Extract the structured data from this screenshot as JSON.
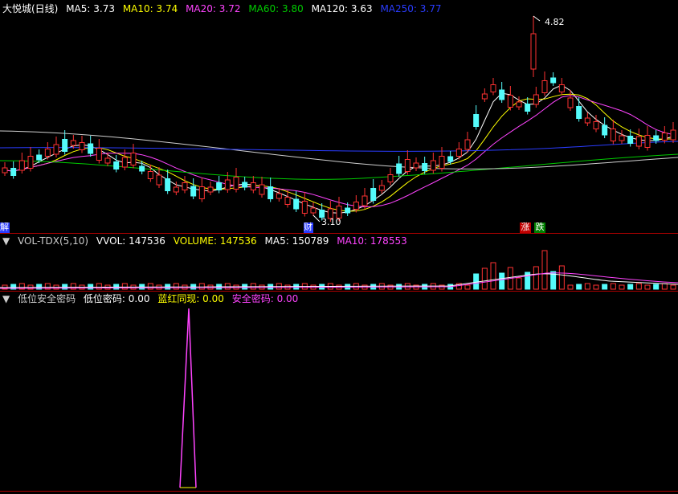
{
  "main": {
    "title": "大悦城(日线)",
    "ma": [
      {
        "label": "MA5: 3.73",
        "color": "#ffffff"
      },
      {
        "label": "MA10: 3.74",
        "color": "#ffff00"
      },
      {
        "label": "MA20: 3.72",
        "color": "#ff44ff"
      },
      {
        "label": "MA60: 3.80",
        "color": "#00cc00"
      },
      {
        "label": "MA120: 3.63",
        "color": "#ffffff"
      },
      {
        "label": "MA250: 3.77",
        "color": "#2a3cff"
      }
    ],
    "high_label": "4.82",
    "low_label": "3.10",
    "tag_left": "解",
    "tag_cai": "财",
    "tag_zhang": "涨",
    "tag_die": "跌"
  },
  "volume": {
    "legend": [
      {
        "label": "VOL-TDX(5,10)",
        "color": "#cccccc"
      },
      {
        "label": "VVOL: 147536",
        "color": "#ffffff"
      },
      {
        "label": "VOLUME: 147536",
        "color": "#ffff00"
      },
      {
        "label": "MA5: 150789",
        "color": "#ffffff"
      },
      {
        "label": "MA10: 178553",
        "color": "#ff44ff"
      }
    ]
  },
  "indicator": {
    "legend": [
      {
        "label": "低位安全密码",
        "color": "#cccccc"
      },
      {
        "label": "低位密码: 0.00",
        "color": "#ffffff"
      },
      {
        "label": "蓝红同现: 0.00",
        "color": "#ffff00"
      },
      {
        "label": "安全密码: 0.00",
        "color": "#ff44ff"
      }
    ]
  },
  "colors": {
    "up": "#ff3232",
    "down": "#54fcfc",
    "frame": "#b00000",
    "magenta": "#ff44ff",
    "yellow": "#ffff00",
    "white": "#ffffff",
    "green": "#00cc00",
    "blue": "#2a3cff",
    "grey": "#cfcfcf"
  }
}
